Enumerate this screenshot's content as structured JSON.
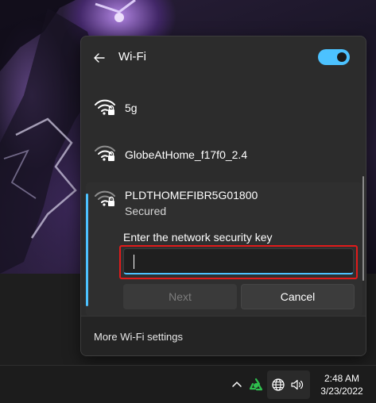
{
  "flyout": {
    "title": "Wi-Fi",
    "wifi_enabled": true,
    "networks": [
      {
        "name": "5g",
        "secured": true
      },
      {
        "name": "GlobeAtHome_f17f0_2.4",
        "secured": true
      },
      {
        "name": "PLDTHOMEFIBR5G01800",
        "secured": true,
        "status": "Secured"
      }
    ],
    "connect": {
      "key_label": "Enter the network security key",
      "key_value": "",
      "next_label": "Next",
      "cancel_label": "Cancel"
    },
    "footer": {
      "more_settings": "More Wi-Fi settings"
    }
  },
  "taskbar": {
    "time": "2:48 AM",
    "date": "3/23/2022",
    "tray_icons": [
      "chevron-up-icon",
      "recycle-icon",
      "globe-icon",
      "speaker-icon"
    ]
  },
  "colors": {
    "accent": "#4cc2ff",
    "highlight": "#e11b1b"
  }
}
